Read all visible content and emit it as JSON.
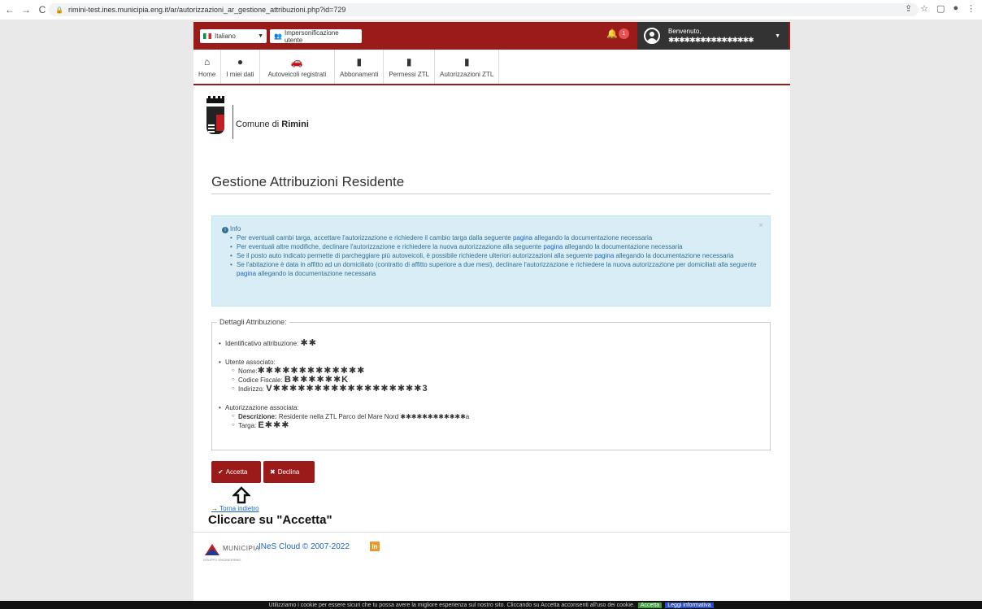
{
  "browser": {
    "url": "rimini-test.ines.municipia.eng.it/ar/autorizzazioni_ar_gestione_attribuzioni.php?id=729"
  },
  "topbar": {
    "language": "Italiano",
    "impersonation": "Impersonificazione utente",
    "notifications_count": "1",
    "welcome": "Benvenuto,",
    "username_masked": "✱✱✱✱✱✱✱✱✱✱✱✱✱✱✱✱"
  },
  "nav": {
    "items": [
      {
        "label": "Home"
      },
      {
        "label": "I miei dati"
      },
      {
        "label": "Autoveicoli registrati"
      },
      {
        "label": "Abbonamenti"
      },
      {
        "label": "Permessi ZTL"
      },
      {
        "label": "Autorizzazioni ZTL"
      }
    ]
  },
  "logo": {
    "prefix": "Comune di ",
    "name": "Rimini"
  },
  "page": {
    "title": "Gestione Attribuzioni Residente"
  },
  "info": {
    "heading": "Info",
    "items": [
      {
        "before": "Per eventuali cambi targa, accettare l'autorizzazione e richiedere il cambio targa dalla seguente ",
        "link": "pagina",
        "after": " allegando la documentazione necessaria"
      },
      {
        "before": "Per eventuali altre modifiche, declinare l'autorizzazione e richiedere la nuova autorizzazione alla seguente ",
        "link": "pagina",
        "after": " allegando la documentazione necessaria"
      },
      {
        "before": "Se il posto auto indicato permette di parcheggiare più autoveicoli, è possibile richiedere ulteriori autorizzazioni alla seguente ",
        "link": "pagina",
        "after": " allegando la documentazione necessaria"
      },
      {
        "before": "Se l'abitazione è data in affitto ad un domiciliato (contratto di affitto superiore a due mesi), declinare l'autorizzazione e richiedere la nuova autorizzazione per domiciliati alla seguente ",
        "link": "pagina",
        "after": " allegando la documentazione necessaria"
      }
    ]
  },
  "details": {
    "legend": "Dettagli Attribuzione:",
    "id_label": "Identificativo attribuzione:",
    "id_value": "✱✱",
    "user_label": "Utente associato:",
    "name_label": "Nome:",
    "name_value": "✱✱✱✱✱✱✱✱✱✱✱✱✱",
    "cf_label": "Codice Fiscale:",
    "cf_value": "B✱✱✱✱✱✱K",
    "address_label": "Indirizzo:",
    "address_value": "V✱✱✱✱✱✱✱✱✱✱✱✱✱✱✱✱✱✱3",
    "auth_label": "Autorizzazione associata:",
    "desc_label": "Descrizione:",
    "desc_value": "Residente nella ZTL Parco del Mare Nord ✱✱✱✱✱✱✱✱✱✱✱✱a",
    "plate_label": "Targa:",
    "plate_value": "E✱✱✱"
  },
  "actions": {
    "accept": "Accetta",
    "decline": "Declina",
    "back": "Torna indietro"
  },
  "instruction": "Cliccare su \"Accetta\"",
  "footer": {
    "municipia": "MUNICIPIA",
    "municipia_sub": "GRUPPO ENGINEERING",
    "copyright": "INeS Cloud © 2007-2022",
    "linkedin": "in"
  },
  "cookie": {
    "text": "Utilizziamo i cookie per essere sicuri che tu possa avere la migliore esperienza sul nostro sito. Cliccando su Accetta acconsenti all'uso dei cookie.",
    "accept": "Accetta",
    "info": "Leggi informativa"
  }
}
